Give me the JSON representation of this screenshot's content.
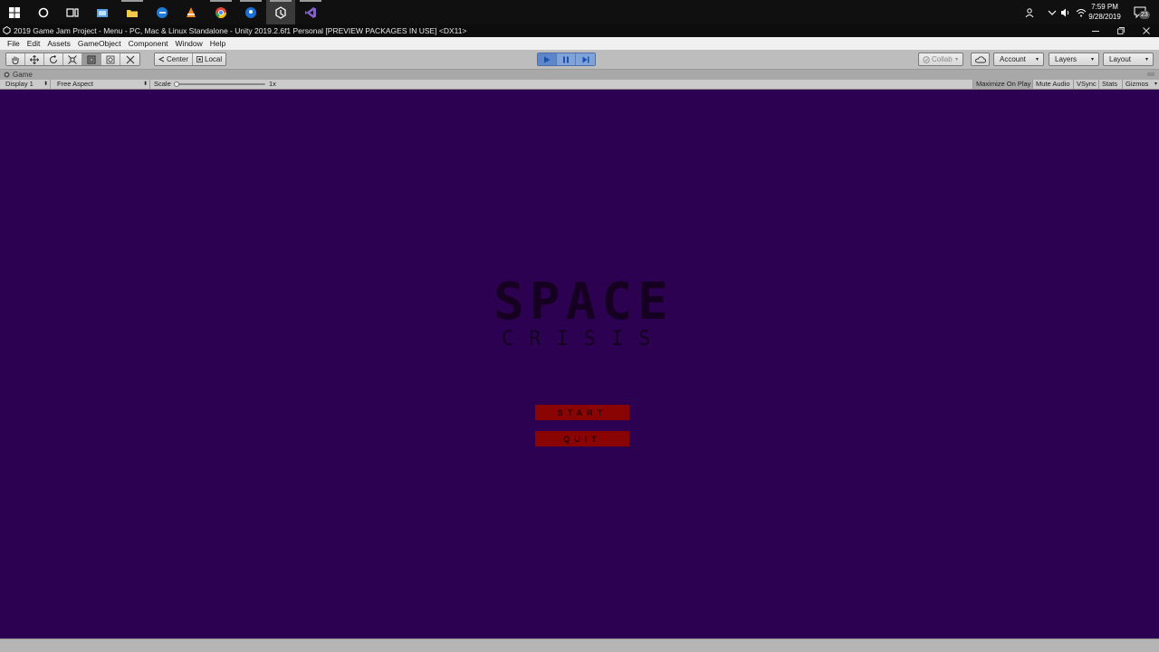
{
  "taskbar": {
    "apps": [
      {
        "name": "start-icon"
      },
      {
        "name": "cortana-icon"
      },
      {
        "name": "task-view-icon"
      },
      {
        "name": "store-icon"
      },
      {
        "name": "file-explorer-icon"
      },
      {
        "name": "edge-icon"
      },
      {
        "name": "vlc-icon"
      },
      {
        "name": "chrome-icon"
      },
      {
        "name": "maps-icon"
      },
      {
        "name": "unity-icon"
      },
      {
        "name": "visual-studio-icon"
      }
    ],
    "clock_time": "7:59 PM",
    "clock_date": "9/28/2019",
    "notification_count": "23"
  },
  "window": {
    "title": "2019 Game Jam Project - Menu - PC, Mac & Linux Standalone - Unity 2019.2.6f1 Personal [PREVIEW PACKAGES IN USE] <DX11>"
  },
  "menu": {
    "items": [
      "File",
      "Edit",
      "Assets",
      "GameObject",
      "Component",
      "Window",
      "Help"
    ]
  },
  "toolbar": {
    "pivot_label": "Center",
    "space_label": "Local",
    "collab_label": "Collab",
    "account_label": "Account",
    "layers_label": "Layers",
    "layout_label": "Layout"
  },
  "game_panel": {
    "tab_label": "Game",
    "display_label": "Display 1",
    "aspect_label": "Free Aspect",
    "scale_label": "Scale",
    "scale_value": "1x",
    "maximize_label": "Maximize On Play",
    "mute_label": "Mute Audio",
    "vsync_label": "VSync",
    "stats_label": "Stats",
    "gizmos_label": "Gizmos"
  },
  "game": {
    "title_main": "SPACE",
    "title_sub": "CRISIS",
    "start_label": "START",
    "quit_label": "QUIT",
    "background_color": "#2d0152",
    "button_color": "#8b0404"
  }
}
